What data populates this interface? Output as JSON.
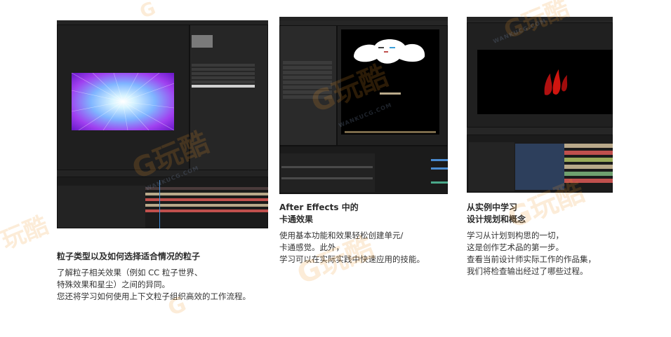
{
  "cards": [
    {
      "title_lines": [
        "粒子类型以及如何选择适合情况的粒子"
      ],
      "body_lines": [
        "了解粒子相关效果（例如 CC 粒子世界、",
        "特殊效果和星尘）之间的异同。",
        "您还将学习如何使用上下文粒子组织高效的工作流程。"
      ]
    },
    {
      "title_lines": [
        "After Effects 中的",
        "卡通效果"
      ],
      "body_lines": [
        "使用基本功能和效果轻松创建单元/",
        "卡通感觉。此外，",
        "学习可以在实际实践中快速应用的技能。"
      ]
    },
    {
      "title_lines": [
        "从实例中学习",
        "设计规划和概念"
      ],
      "body_lines": [
        "学习从计划到构思的一切，",
        "这是创作艺术品的第一步。",
        "查看当前设计师实际工作的作品集，",
        "我们将检查输出经过了哪些过程。"
      ]
    }
  ],
  "watermark": {
    "brand": "玩酷",
    "domain": "WANKUCG.COM"
  },
  "colors": {
    "accent_timeline": "#c0504d",
    "cartoon_red": "#c0120e"
  }
}
